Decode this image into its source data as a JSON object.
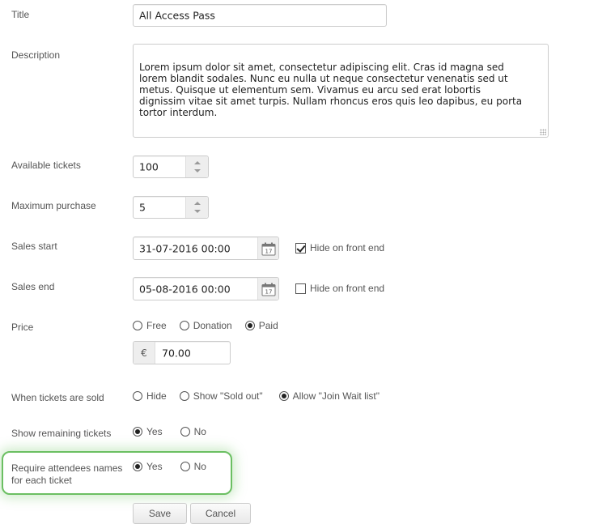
{
  "form": {
    "title": {
      "label": "Title",
      "value": "All Access Pass"
    },
    "description": {
      "label": "Description",
      "value": "Lorem ipsum dolor sit amet, consectetur adipiscing elit. Cras id magna sed\nlorem blandit sodales. Nunc eu nulla ut neque consectetur venenatis sed ut\nmetus. Quisque ut elementum sem. Vivamus eu arcu sed erat lobortis\ndignissim vitae sit amet turpis. Nullam rhoncus eros quis leo dapibus, eu porta\ntortor interdum."
    },
    "available_tickets": {
      "label": "Available tickets",
      "value": "100"
    },
    "maximum_purchase": {
      "label": "Maximum purchase",
      "value": "5"
    },
    "sales_start": {
      "label": "Sales start",
      "value": "31-07-2016 00:00",
      "calendar_day": "17",
      "hide_label": "Hide on front end",
      "hide_checked": true
    },
    "sales_end": {
      "label": "Sales end",
      "value": "05-08-2016 00:00",
      "calendar_day": "17",
      "hide_label": "Hide on front end",
      "hide_checked": false
    },
    "price": {
      "label": "Price",
      "options": [
        "Free",
        "Donation",
        "Paid"
      ],
      "selected": "Paid",
      "currency_symbol": "€",
      "value": "70.00"
    },
    "when_sold": {
      "label": "When tickets are sold",
      "options": [
        "Hide",
        "Show \"Sold out\"",
        "Allow \"Join Wait list\""
      ],
      "selected": "Allow \"Join Wait list\""
    },
    "show_remaining": {
      "label": "Show remaining tickets",
      "options": [
        "Yes",
        "No"
      ],
      "selected": "Yes"
    },
    "require_names": {
      "label_line1": "Require attendees names",
      "label_line2": "for each ticket",
      "options": [
        "Yes",
        "No"
      ],
      "selected": "Yes"
    }
  },
  "buttons": {
    "save": "Save",
    "cancel": "Cancel"
  },
  "colors": {
    "highlight_border": "#6bbf62"
  }
}
